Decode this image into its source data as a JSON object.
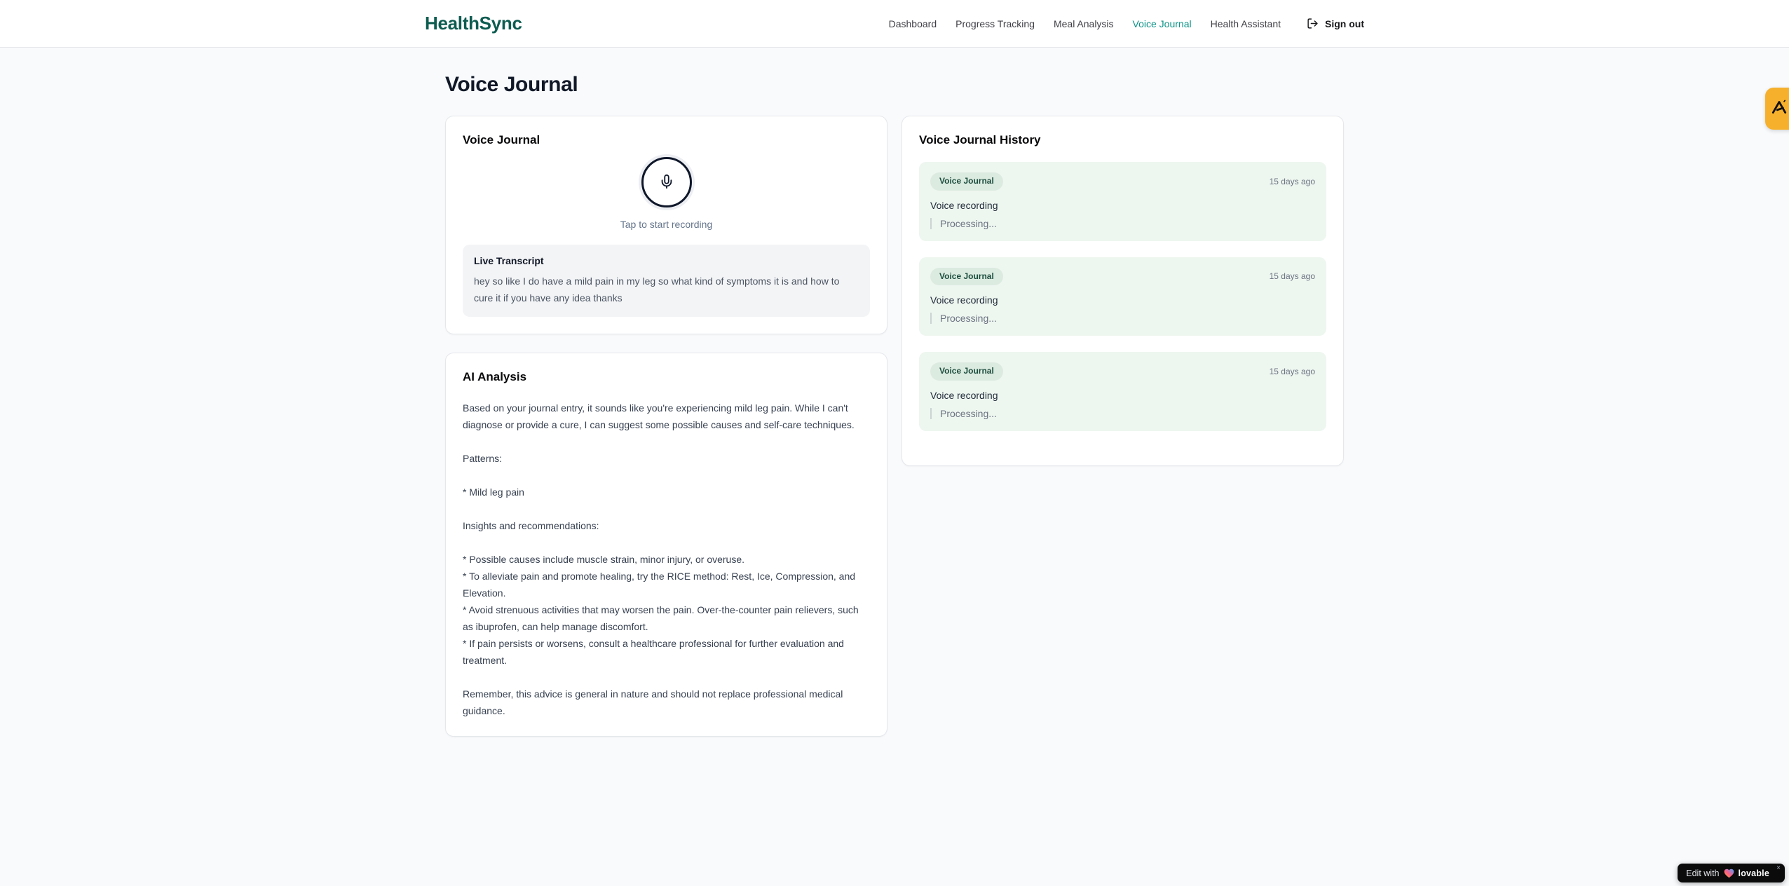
{
  "header": {
    "brand": "HealthSync",
    "nav": [
      {
        "label": "Dashboard"
      },
      {
        "label": "Progress Tracking"
      },
      {
        "label": "Meal Analysis"
      },
      {
        "label": "Voice Journal",
        "active": true
      },
      {
        "label": "Health Assistant"
      }
    ],
    "sign_out_label": "Sign out"
  },
  "page": {
    "title": "Voice Journal"
  },
  "recorder_card": {
    "title": "Voice Journal",
    "tap_hint": "Tap to start recording",
    "live_transcript": {
      "title": "Live Transcript",
      "text": "hey so like I do have a mild pain in my leg so what kind of symptoms it is and how to cure it if you have any idea thanks"
    }
  },
  "analysis_card": {
    "title": "AI Analysis",
    "body": "Based on your journal entry, it sounds like you're experiencing mild leg pain. While I can't diagnose or provide a cure, I can suggest some possible causes and self-care techniques.\n\nPatterns:\n\n* Mild leg pain\n\nInsights and recommendations:\n\n* Possible causes include muscle strain, minor injury, or overuse.\n* To alleviate pain and promote healing, try the RICE method: Rest, Ice, Compression, and Elevation.\n* Avoid strenuous activities that may worsen the pain. Over-the-counter pain relievers, such as ibuprofen, can help manage discomfort.\n* If pain persists or worsens, consult a healthcare professional for further evaluation and treatment.\n\nRemember, this advice is general in nature and should not replace professional medical guidance."
  },
  "history_card": {
    "title": "Voice Journal History",
    "items": [
      {
        "badge": "Voice Journal",
        "time": "15 days ago",
        "label": "Voice recording",
        "status": "Processing..."
      },
      {
        "badge": "Voice Journal",
        "time": "15 days ago",
        "label": "Voice recording",
        "status": "Processing..."
      },
      {
        "badge": "Voice Journal",
        "time": "15 days ago",
        "label": "Voice recording",
        "status": "Processing..."
      }
    ]
  },
  "floating": {
    "edit_badge_prefix": "Edit with",
    "edit_badge_brand": "lovable",
    "edit_badge_close": "×"
  },
  "icons": {
    "mic": "mic-icon",
    "logout": "logout-icon",
    "heart": "gradient-heart-icon",
    "a11y": "accessibility-widget-icon"
  },
  "colors": {
    "brand_text": "#0d5c50",
    "nav_active": "#0d9488",
    "page_bg": "#f8fafc",
    "card_border": "#e5e7eb",
    "history_item_bg": "#eef6f0",
    "badge_bg": "#dcebe0",
    "badge_text": "#1b4d3e",
    "a11y_badge_bg": "#f6b02c",
    "edit_badge_bg": "#0b0b0c"
  }
}
